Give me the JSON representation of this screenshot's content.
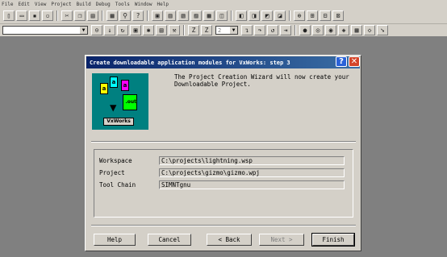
{
  "menu": [
    "File",
    "Edit",
    "View",
    "Project",
    "Build",
    "Debug",
    "Tools",
    "Window",
    "Help"
  ],
  "toolbar": {
    "zoom_value": "2"
  },
  "dialog": {
    "title": "Create downloadable application modules for VxWorks:  step 3",
    "illustration": {
      "doc_a": "a",
      "doc_b": "a",
      "doc_c": "a",
      "out_label": ".out",
      "product_label": "VxWorks"
    },
    "intro_line1": "The Project Creation Wizard will now create your",
    "intro_line2": "Downloadable Project.",
    "fields": [
      {
        "label": "Workspace",
        "value": "C:\\projects\\lightning.wsp"
      },
      {
        "label": "Project",
        "value": "C:\\projects\\gizmo\\gizmo.wpj"
      },
      {
        "label": "Tool Chain",
        "value": "SIMNTgnu"
      }
    ],
    "buttons": {
      "help": "Help",
      "cancel": "Cancel",
      "back": "< Back",
      "next": "Next >",
      "finish": "Finish"
    }
  },
  "colors": {
    "titlebar": "#0a246a",
    "desktop": "#808080",
    "illustration_bg": "#008080"
  }
}
